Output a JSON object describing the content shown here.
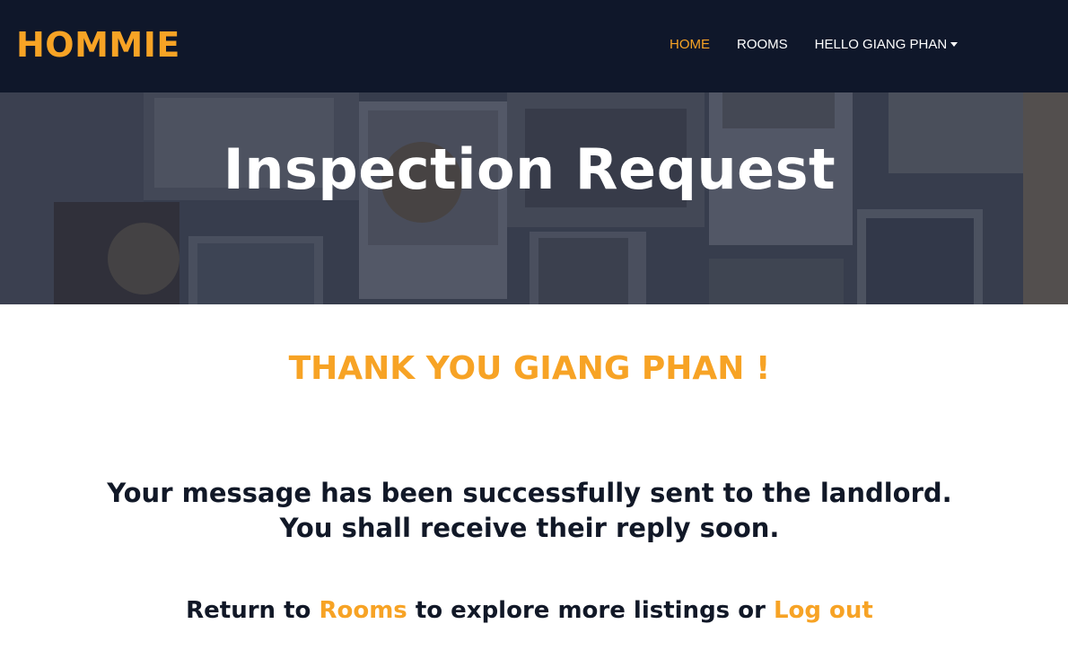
{
  "navbar": {
    "brand": "HOMMIE",
    "links": {
      "home": "HOME",
      "rooms": "ROOMS",
      "user": "HELLO GIANG PHAN"
    }
  },
  "hero": {
    "title": "Inspection Request"
  },
  "content": {
    "thanks": "THANK YOU GIANG PHAN !",
    "message_line1": "Your message has been successfully sent to the landlord.",
    "message_line2": "You shall receive their reply soon.",
    "return_prefix": "Return to ",
    "rooms_link": "Rooms",
    "return_middle": " to explore more listings or ",
    "logout_link": "Log out"
  },
  "colors": {
    "accent": "#f7a325",
    "navbar_bg": "#0f172a",
    "text_dark": "#111827"
  },
  "icons": {
    "user_dropdown": "caret-down-icon"
  }
}
